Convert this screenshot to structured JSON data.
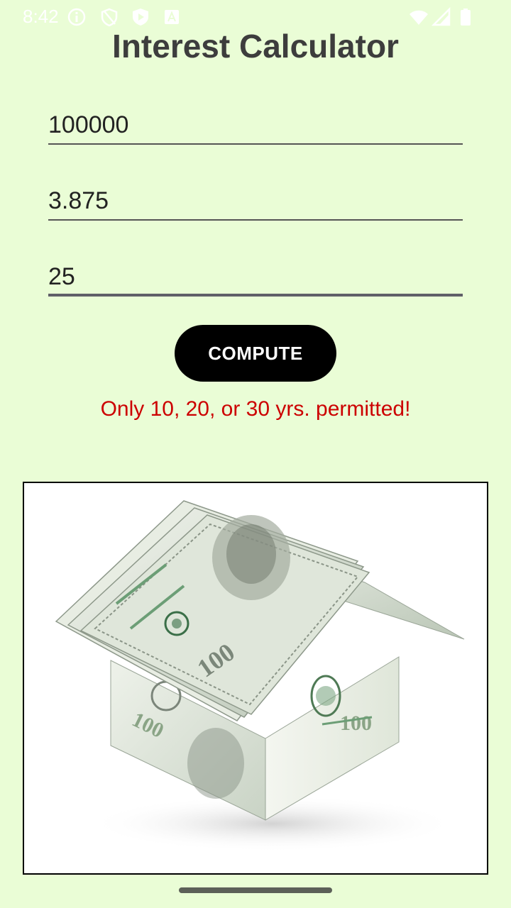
{
  "status_bar": {
    "time": "8:42"
  },
  "app": {
    "title": "Interest Calculator"
  },
  "form": {
    "principal_value": "100000",
    "rate_value": "3.875",
    "years_value": "25",
    "compute_label": "COMPUTE",
    "error_text": "Only 10, 20, or 30 yrs. permitted!"
  },
  "image": {
    "subject": "house made of hundred dollar bills"
  },
  "colors": {
    "background": "#eafdd6",
    "error": "#cc0000",
    "button": "#000000"
  }
}
